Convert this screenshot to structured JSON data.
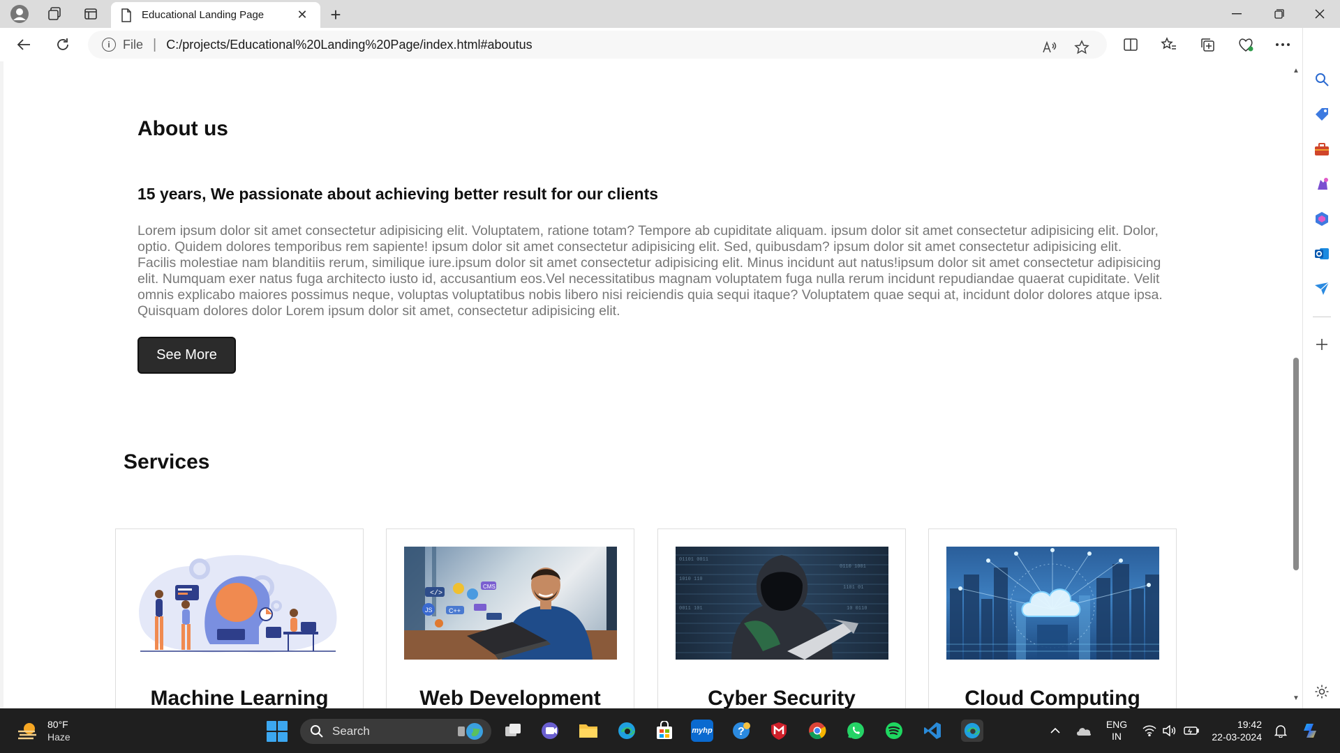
{
  "browser": {
    "tab_title": "Educational Landing Page",
    "tab_close": "✕",
    "new_tab": "+",
    "omnibox_file_label": "File",
    "omnibox_sep": "|",
    "url": "C:/projects/Educational%20Landing%20Page/index.html#aboutus"
  },
  "page": {
    "about": {
      "title": "About us",
      "subtitle": "15 years, We passionate about achieving better result for our clients",
      "body": "Lorem ipsum dolor sit amet consectetur adipisicing elit. Voluptatem, ratione totam? Tempore ab cupiditate aliquam. ipsum dolor sit amet consectetur adipisicing elit. Dolor, optio. Quidem dolores temporibus rem sapiente! ipsum dolor sit amet consectetur adipisicing elit. Sed, quibusdam? ipsum dolor sit amet consectetur adipisicing elit. Facilis molestiae nam blanditiis rerum, similique iure.ipsum dolor sit amet consectetur adipisicing elit. Minus incidunt aut natus!ipsum dolor sit amet consectetur adipisicing elit. Numquam exer natus fuga architecto iusto id, accusantium eos.Vel necessitatibus magnam voluptatem fuga nulla rerum incidunt repudiandae quaerat cupiditate. Velit omnis explicabo maiores possimus neque, voluptas voluptatibus nobis libero nisi reiciendis quia sequi itaque? Voluptatem quae sequi at, incidunt dolor dolores atque ipsa. Quisquam dolores dolor Lorem ipsum dolor sit amet, consectetur adipisicing elit.",
      "button": "See More"
    },
    "services": {
      "title": "Services",
      "cards": [
        {
          "title": "Machine Learning",
          "image": "machine-learning-illustration"
        },
        {
          "title": "Web Development",
          "image": "web-developer-photo"
        },
        {
          "title": "Cyber Security",
          "image": "hacker-photo"
        },
        {
          "title": "Cloud Computing",
          "image": "cloud-city-photo"
        }
      ]
    }
  },
  "taskbar": {
    "weather_temp": "80°F",
    "weather_desc": "Haze",
    "search_placeholder": "Search",
    "lang_line1": "ENG",
    "lang_line2": "IN",
    "time": "19:42",
    "date": "22-03-2024",
    "hp_label": "myhp"
  },
  "colors": {
    "accent_button": "#2b2b2b",
    "body_text": "#777777",
    "taskbar_bg": "#1f1f1f"
  }
}
